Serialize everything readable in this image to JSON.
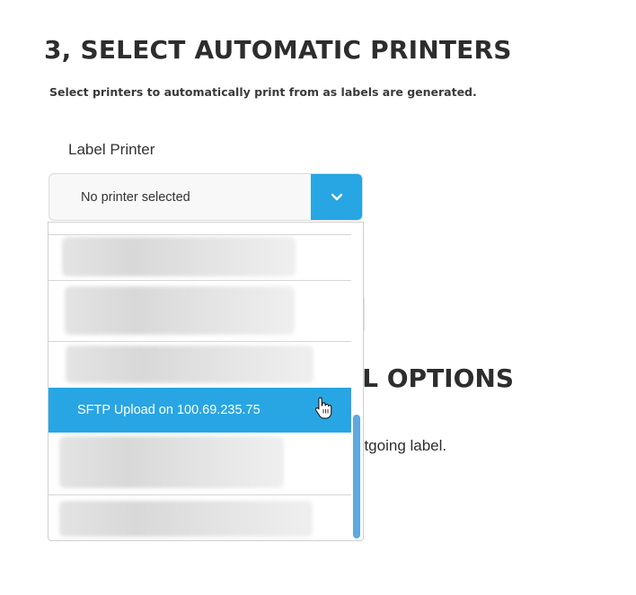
{
  "section": {
    "title": "3, SELECT AUTOMATIC PRINTERS",
    "subtitle": "Select printers to automatically print from as labels are generated."
  },
  "label_printer": {
    "label": "Label Printer",
    "value": "No printer selected",
    "toggle_icon": "chevron-down-icon"
  },
  "dropdown": {
    "options": [
      {
        "label": "",
        "redacted": true
      },
      {
        "label": "",
        "redacted": true
      },
      {
        "label": "",
        "redacted": true
      },
      {
        "label": "SFTP Upload on 100.69.235.75",
        "selected": true
      },
      {
        "label": "",
        "redacted": true
      },
      {
        "label": "",
        "redacted": true
      }
    ]
  },
  "obscured_section": {
    "title_visible_fragment": "L OPTIONS",
    "subtitle_visible_fragment": "utgoing label."
  },
  "colors": {
    "accent": "#28a5e3",
    "scrollbar": "#5fa8e0",
    "text": "#2d2d2d"
  }
}
